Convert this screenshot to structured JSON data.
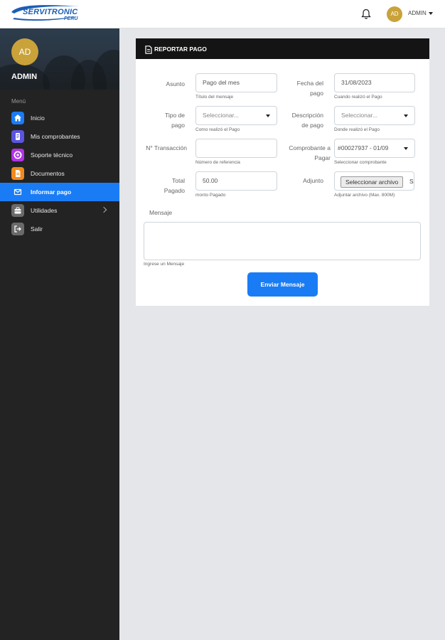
{
  "brand": {
    "logo_main": "SERVITRONIC",
    "logo_sub": "PERU"
  },
  "header": {
    "avatar_initials": "AD",
    "user_label": "ADMIN",
    "icons": [
      "bell-icon",
      "chevron-down-icon"
    ]
  },
  "sidebar": {
    "avatar_initials": "AD",
    "user_name": "ADMIN",
    "menu_label": "Menú",
    "items": [
      {
        "label": "Inicio",
        "icon": "home-icon",
        "color": "#1a7cf5"
      },
      {
        "label": "Mis comprobantes",
        "icon": "receipt-icon",
        "color": "#5a55e0"
      },
      {
        "label": "Soporte técnico",
        "icon": "lifebuoy-icon",
        "color": "#b233e8"
      },
      {
        "label": "Documentos",
        "icon": "document-icon",
        "color": "#f08a1c"
      },
      {
        "label": "Informar pago",
        "icon": "envelope-icon",
        "color": "#1a7cf5",
        "active": true
      },
      {
        "label": "Utilidades",
        "icon": "toolbox-icon",
        "color": "#6a6a6a",
        "has_submenu": true
      },
      {
        "label": "Salir",
        "icon": "logout-icon",
        "color": "#6a6a6a"
      }
    ]
  },
  "form": {
    "title": "REPORTAR PAGO",
    "asunto": {
      "label": "Asunto",
      "value": "Pago del mes",
      "help": "Título del mensaje"
    },
    "fecha": {
      "label": "Fecha del pago",
      "value": "31/08/2023",
      "help": "Cuando realizó el Pago"
    },
    "tipo": {
      "label": "Tipo de pago",
      "value": "Seleccionar...",
      "help": "Como realizó el Pago"
    },
    "descripcion": {
      "label": "Descripción de pago",
      "value": "Seleccionar...",
      "help": "Donde realizó el Pago"
    },
    "transaccion": {
      "label": "N° Transacción",
      "value": "",
      "help": "Número de referencia"
    },
    "comprobante": {
      "label": "Comprobante a Pagar",
      "value": "#00027937 - 01/09",
      "help": "Seleccionar comprobante"
    },
    "total": {
      "label": "Total Pagado",
      "value": "50.00",
      "help": "monto Pagado"
    },
    "adjunto": {
      "label": "Adjunto",
      "button": "Seleccionar archivo",
      "status": "S",
      "help": "Adjuntar archivo (Max. 800M)"
    },
    "mensaje": {
      "label": "Mensaje",
      "help": "Ingrese un Mensaje"
    },
    "submit": "Enviar Mensaje"
  }
}
